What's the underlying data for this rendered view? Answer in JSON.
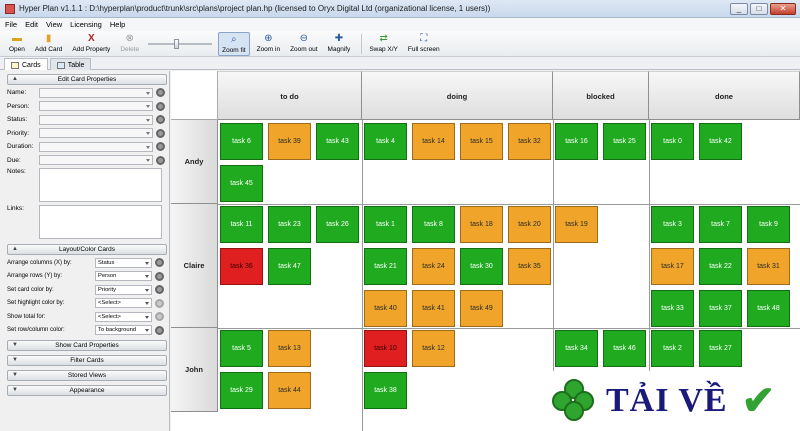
{
  "window": {
    "title": "Hyper Plan v1.1.1 : D:\\hyperplan\\product\\trunk\\src\\plans\\project plan.hp (licensed to Oryx Digital Ltd (organizational license, 1 users))"
  },
  "menu": [
    "File",
    "Edit",
    "View",
    "Licensing",
    "Help"
  ],
  "toolbar": {
    "open": "Open",
    "add_card": "Add Card",
    "add_property": "Add Property",
    "delete": "Delete",
    "zoom_fit": "Zoom fit",
    "zoom_in": "Zoom in",
    "zoom_out": "Zoom out",
    "magnify": "Magnify",
    "swap": "Swap X/Y",
    "full_screen": "Full screen"
  },
  "view_tabs": [
    "Cards",
    "Table"
  ],
  "sidebar": {
    "edit_header": "Edit Card Properties",
    "fields": [
      "Name:",
      "Person:",
      "Status:",
      "Priority:",
      "Duration:",
      "Due:"
    ],
    "notes_label": "Notes:",
    "links_label": "Links:",
    "layout_header": "Layout/Color Cards",
    "layout_rows": [
      {
        "label": "Arrange columns (X) by:",
        "value": "Status"
      },
      {
        "label": "Arrange rows (Y) by:",
        "value": "Person"
      },
      {
        "label": "Set card color by:",
        "value": "Priority"
      },
      {
        "label": "Set highlight color by:",
        "value": "<Select>"
      },
      {
        "label": "Show total for:",
        "value": "<Select>"
      },
      {
        "label": "Set row/column color:",
        "value": "To background"
      }
    ],
    "sections": [
      "Show Card Properties",
      "Filter Cards",
      "Stored Views",
      "Appearance"
    ]
  },
  "board": {
    "columns": [
      "to do",
      "doing",
      "blocked",
      "done"
    ],
    "rows": [
      "Andy",
      "Claire",
      "John"
    ],
    "colors": {
      "green": "#1faa1f",
      "orange": "#f0a52a",
      "red": "#e02020"
    },
    "cards": {
      "andy_todo": [
        {
          "t": "task 6",
          "c": "green"
        },
        {
          "t": "task 39",
          "c": "orange"
        },
        {
          "t": "task 43",
          "c": "green"
        },
        {
          "t": "task 45",
          "c": "green"
        }
      ],
      "andy_doing": [
        {
          "t": "task 4",
          "c": "green"
        },
        {
          "t": "task 14",
          "c": "orange"
        },
        {
          "t": "task 15",
          "c": "orange"
        },
        {
          "t": "task 32",
          "c": "orange"
        }
      ],
      "andy_blocked": [
        {
          "t": "task 16",
          "c": "green"
        },
        {
          "t": "task 25",
          "c": "green"
        }
      ],
      "andy_done": [
        {
          "t": "task 0",
          "c": "green"
        },
        {
          "t": "task 42",
          "c": "green"
        }
      ],
      "claire_todo": [
        {
          "t": "task 11",
          "c": "green"
        },
        {
          "t": "task 23",
          "c": "green"
        },
        {
          "t": "task 26",
          "c": "green"
        },
        {
          "t": "task 36",
          "c": "red"
        },
        {
          "t": "task 47",
          "c": "green"
        }
      ],
      "claire_doing": [
        {
          "t": "task 1",
          "c": "green"
        },
        {
          "t": "task 8",
          "c": "green"
        },
        {
          "t": "task 18",
          "c": "orange"
        },
        {
          "t": "task 20",
          "c": "orange"
        },
        {
          "t": "task 21",
          "c": "green"
        },
        {
          "t": "task 24",
          "c": "orange"
        },
        {
          "t": "task 30",
          "c": "green"
        },
        {
          "t": "task 35",
          "c": "orange"
        },
        {
          "t": "task 40",
          "c": "orange"
        },
        {
          "t": "task 41",
          "c": "orange"
        },
        {
          "t": "task 49",
          "c": "orange"
        }
      ],
      "claire_blocked": [
        {
          "t": "task 19",
          "c": "orange"
        }
      ],
      "claire_done": [
        {
          "t": "task 3",
          "c": "green"
        },
        {
          "t": "task 7",
          "c": "green"
        },
        {
          "t": "task 9",
          "c": "green"
        },
        {
          "t": "task 17",
          "c": "orange"
        },
        {
          "t": "task 22",
          "c": "green"
        },
        {
          "t": "task 31",
          "c": "orange"
        },
        {
          "t": "task 33",
          "c": "green"
        },
        {
          "t": "task 37",
          "c": "green"
        },
        {
          "t": "task 48",
          "c": "green"
        }
      ],
      "john_todo": [
        {
          "t": "task 5",
          "c": "green"
        },
        {
          "t": "task 13",
          "c": "orange"
        },
        {
          "t": "task 29",
          "c": "green"
        },
        {
          "t": "task 44",
          "c": "orange"
        }
      ],
      "john_doing": [
        {
          "t": "task 10",
          "c": "red"
        },
        {
          "t": "task 12",
          "c": "orange"
        },
        {
          "t": "task 38",
          "c": "green"
        }
      ],
      "john_blocked": [
        {
          "t": "task 34",
          "c": "green"
        },
        {
          "t": "task 46",
          "c": "green"
        }
      ],
      "john_done": [
        {
          "t": "task 2",
          "c": "green"
        },
        {
          "t": "task 27",
          "c": "green"
        }
      ]
    }
  },
  "watermark": {
    "text": "TẢI VỀ",
    "icons": [
      "clover-icon",
      "checkmark-icon"
    ],
    "text_color": "#1a1a7a",
    "check_color": "#32a332"
  }
}
